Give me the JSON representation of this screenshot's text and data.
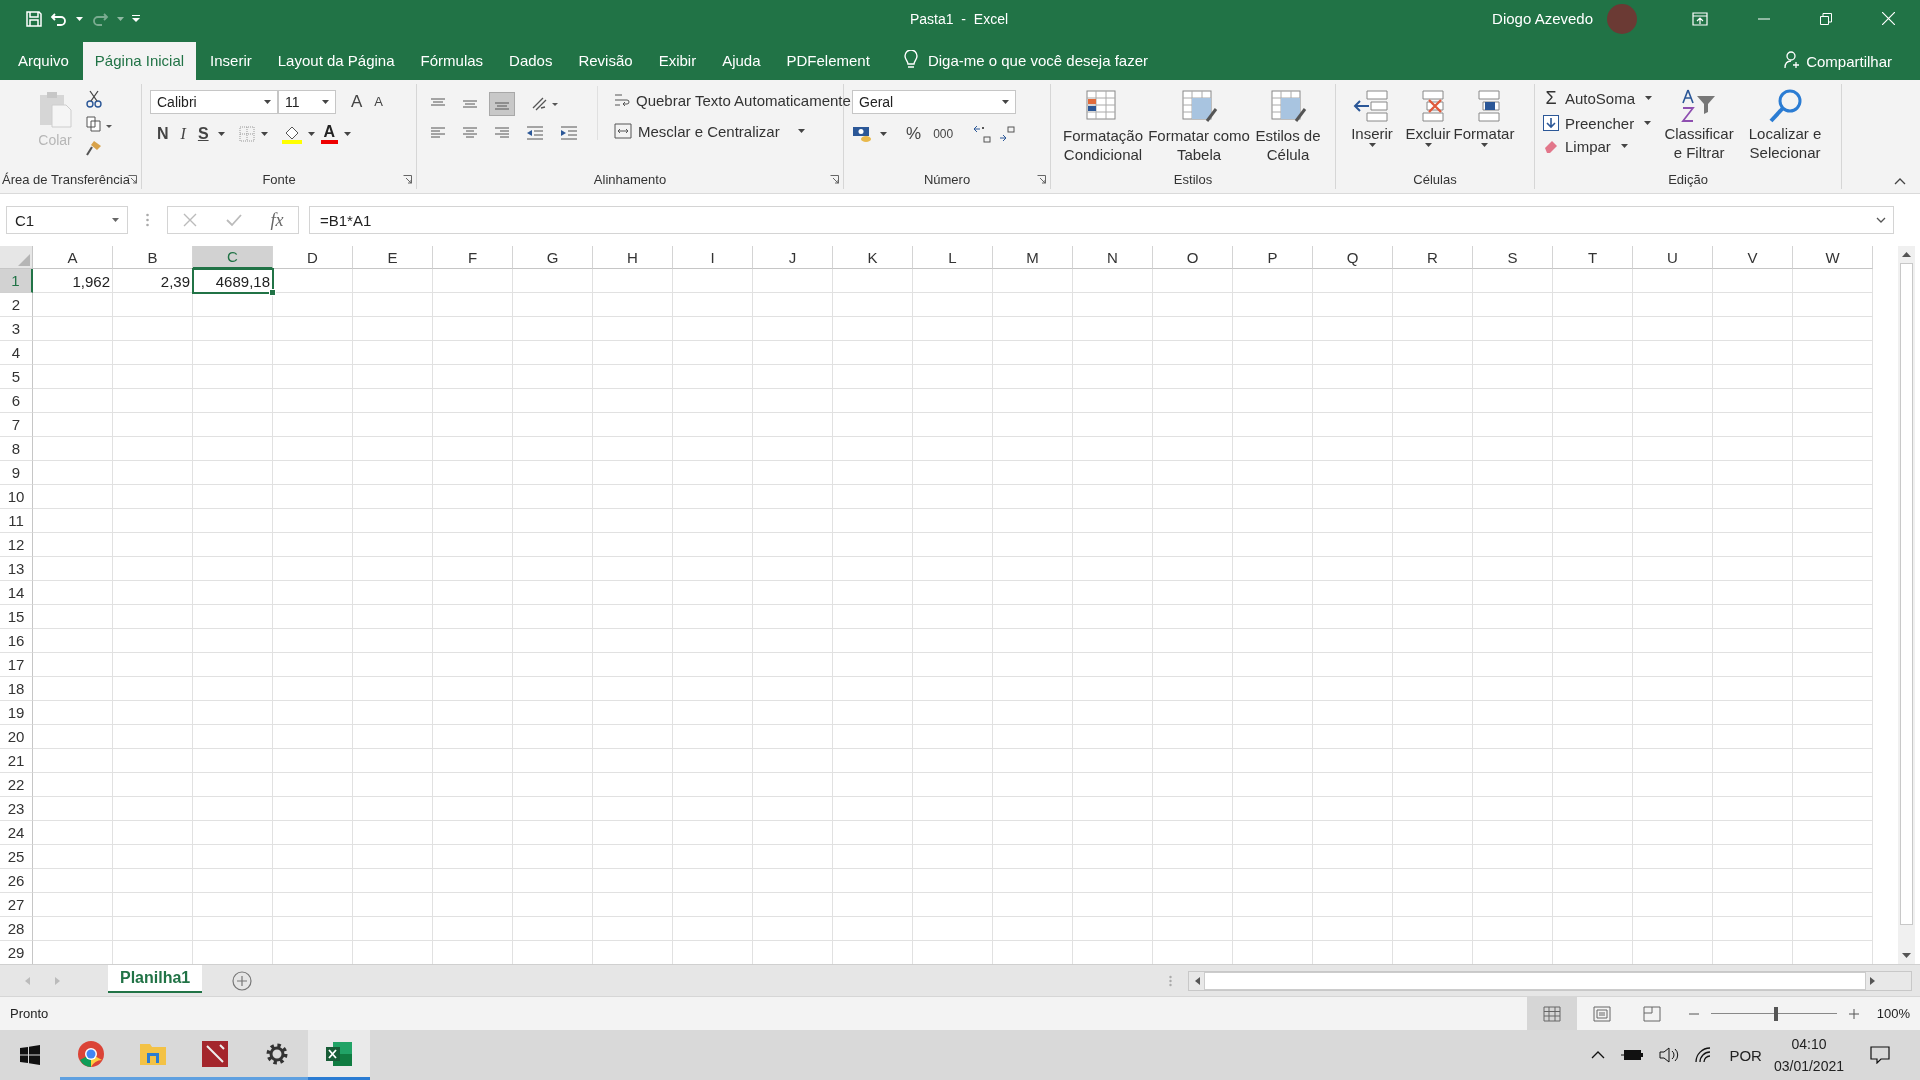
{
  "title_bar": {
    "title": "Pasta1  -  Excel",
    "user": "Diogo Azevedo",
    "redo_disabled": true
  },
  "ribbon_tabs": [
    {
      "label": "Arquivo",
      "selected": false
    },
    {
      "label": "Página Inicial",
      "selected": true
    },
    {
      "label": "Inserir",
      "selected": false
    },
    {
      "label": "Layout da Página",
      "selected": false
    },
    {
      "label": "Fórmulas",
      "selected": false
    },
    {
      "label": "Dados",
      "selected": false
    },
    {
      "label": "Revisão",
      "selected": false
    },
    {
      "label": "Exibir",
      "selected": false
    },
    {
      "label": "Ajuda",
      "selected": false
    },
    {
      "label": "PDFelement",
      "selected": false
    }
  ],
  "tell_me": {
    "placeholder": "Diga-me o que você deseja fazer"
  },
  "share": "Compartilhar",
  "ribbon": {
    "clipboard": {
      "label": "Área de Transferência",
      "paste": "Colar",
      "paste_disabled": true
    },
    "font": {
      "label": "Fonte",
      "family": "Calibri",
      "size": "11",
      "grow": "A",
      "shrink": "A",
      "bold": "N",
      "italic": "I",
      "underline": "S",
      "font_color_glyph": "A"
    },
    "alignment": {
      "label": "Alinhamento",
      "vertical": [
        {
          "selected": false
        },
        {
          "selected": false
        },
        {
          "selected": true
        }
      ],
      "wrap": "Quebrar Texto Automaticamente",
      "merge": "Mesclar e Centralizar"
    },
    "number": {
      "label": "Número",
      "format": "Geral",
      "percent": "%",
      "thousands": "000"
    },
    "styles": {
      "label": "Estilos",
      "buttons": [
        "Formatação Condicional",
        "Formatar como Tabela",
        "Estilos de Célula"
      ]
    },
    "cells": {
      "label": "Células",
      "buttons": [
        "Inserir",
        "Excluir",
        "Formatar"
      ]
    },
    "editing": {
      "label": "Edição",
      "autosum_symbol": "Σ",
      "autosum": "AutoSoma",
      "fill": "Preencher",
      "clear": "Limpar",
      "sort": "Classificar e Filtrar",
      "find": "Localizar e Selecionar"
    }
  },
  "formula_bar": {
    "name_box": "C1",
    "function_label": "fx",
    "formula": "=B1*A1"
  },
  "sheet": {
    "columns": [
      {
        "label": "A",
        "selected": false
      },
      {
        "label": "B",
        "selected": false
      },
      {
        "label": "C",
        "selected": true
      },
      {
        "label": "D",
        "selected": false
      },
      {
        "label": "E",
        "selected": false
      },
      {
        "label": "F",
        "selected": false
      },
      {
        "label": "G",
        "selected": false
      },
      {
        "label": "H",
        "selected": false
      },
      {
        "label": "I",
        "selected": false
      },
      {
        "label": "J",
        "selected": false
      },
      {
        "label": "K",
        "selected": false
      },
      {
        "label": "L",
        "selected": false
      },
      {
        "label": "M",
        "selected": false
      },
      {
        "label": "N",
        "selected": false
      },
      {
        "label": "O",
        "selected": false
      },
      {
        "label": "P",
        "selected": false
      },
      {
        "label": "Q",
        "selected": false
      },
      {
        "label": "R",
        "selected": false
      },
      {
        "label": "S",
        "selected": false
      },
      {
        "label": "T",
        "selected": false
      },
      {
        "label": "U",
        "selected": false
      },
      {
        "label": "V",
        "selected": false
      },
      {
        "label": "W",
        "selected": false
      }
    ],
    "rows": [
      {
        "label": "1",
        "selected": true,
        "cells": [
          {
            "value": "1,962",
            "selected": false
          },
          {
            "value": "2,39",
            "selected": false
          },
          {
            "value": "4689,18",
            "selected": true
          }
        ]
      },
      {
        "label": "2",
        "selected": false
      },
      {
        "label": "3",
        "selected": false
      },
      {
        "label": "4",
        "selected": false
      },
      {
        "label": "5",
        "selected": false
      },
      {
        "label": "6",
        "selected": false
      },
      {
        "label": "7",
        "selected": false
      },
      {
        "label": "8",
        "selected": false
      },
      {
        "label": "9",
        "selected": false
      },
      {
        "label": "10",
        "selected": false
      },
      {
        "label": "11",
        "selected": false
      },
      {
        "label": "12",
        "selected": false
      },
      {
        "label": "13",
        "selected": false
      },
      {
        "label": "14",
        "selected": false
      },
      {
        "label": "15",
        "selected": false
      },
      {
        "label": "16",
        "selected": false
      },
      {
        "label": "17",
        "selected": false
      },
      {
        "label": "18",
        "selected": false
      },
      {
        "label": "19",
        "selected": false
      },
      {
        "label": "20",
        "selected": false
      },
      {
        "label": "21",
        "selected": false
      },
      {
        "label": "22",
        "selected": false
      },
      {
        "label": "23",
        "selected": false
      },
      {
        "label": "24",
        "selected": false
      },
      {
        "label": "25",
        "selected": false
      },
      {
        "label": "26",
        "selected": false
      },
      {
        "label": "27",
        "selected": false
      },
      {
        "label": "28",
        "selected": false
      },
      {
        "label": "29",
        "selected": false
      }
    ]
  },
  "sheet_tabs": [
    {
      "label": "Planilha1",
      "selected": true
    }
  ],
  "status_bar": {
    "status": "Pronto",
    "views": [
      {
        "selected": true
      },
      {
        "selected": false
      },
      {
        "selected": false
      }
    ],
    "zoom": {
      "level": 0.52
    },
    "zoom_label": "100%"
  },
  "taskbar": {
    "apps": [
      {
        "running": true,
        "active": false
      },
      {
        "running": true,
        "active": false
      },
      {
        "running": true,
        "active": false
      },
      {
        "running": true,
        "active": false
      },
      {
        "running": true,
        "active": true
      }
    ],
    "language": "POR",
    "time": "04:10",
    "date": "03/01/2021"
  }
}
